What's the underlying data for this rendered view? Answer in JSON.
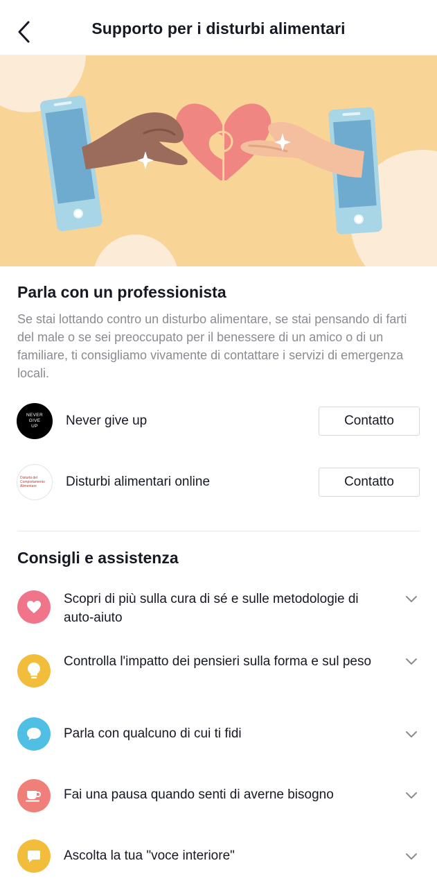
{
  "header": {
    "title": "Supporto per i disturbi alimentari"
  },
  "professional": {
    "title": "Parla con un professionista",
    "description": "Se stai lottando contro un disturbo alimentare, se stai pensando di farti del male o se sei preoccupato per il benessere di un amico o di un familiare, ti consigliamo vivamente di contattare i servizi di emergenza locali.",
    "contacts": [
      {
        "name": "Never give up",
        "button": "Contatto",
        "logo_text": [
          "NEVER",
          "GIVE",
          "UP"
        ]
      },
      {
        "name": "Disturbi alimentari online",
        "button": "Contatto",
        "logo_text": [
          "Disturbi del",
          "Comportamento",
          "Alimentare"
        ]
      }
    ]
  },
  "tips": {
    "title": "Consigli e assistenza",
    "items": [
      {
        "label": "Scopri di più sulla cura di sé e sulle metodologie di auto-aiuto",
        "icon": "heart-icon",
        "color": "#f0758a"
      },
      {
        "label": "Controlla l'impatto dei pensieri sulla forma e sul peso",
        "icon": "lightbulb-icon",
        "color": "#f2bd3b"
      },
      {
        "label": "Parla con qualcuno di cui ti fidi",
        "icon": "chat-bubble-icon",
        "color": "#4fbfe3"
      },
      {
        "label": "Fai una pausa quando senti di averne bisogno",
        "icon": "coffee-cup-icon",
        "color": "#f07f7a"
      },
      {
        "label": "Ascolta la tua \"voce interiore\"",
        "icon": "message-icon",
        "color": "#f2bd3b"
      }
    ]
  },
  "colors": {
    "hero_background": "#f8d497",
    "heart": "#ef8682",
    "phone": "#a8d6e6",
    "screen": "#6fabcf"
  }
}
